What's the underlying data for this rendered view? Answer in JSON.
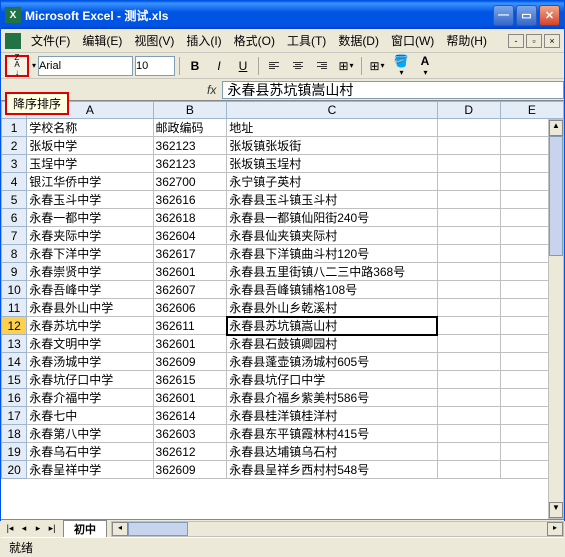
{
  "window": {
    "app": "Microsoft Excel",
    "file": "测试.xls",
    "title": "Microsoft Excel - 测试.xls"
  },
  "menu": {
    "file": "文件(F)",
    "edit": "编辑(E)",
    "view": "视图(V)",
    "insert": "插入(I)",
    "format": "格式(O)",
    "tools": "工具(T)",
    "data": "数据(D)",
    "window": "窗口(W)",
    "help": "帮助(H)"
  },
  "toolbar": {
    "sort_tooltip": "降序排序",
    "font_name": "Arial",
    "font_size": "10",
    "fill_color": "#ffff00",
    "font_color": "#ff0000"
  },
  "formula": {
    "fx": "fx",
    "value": "永春县苏坑镇嵩山村"
  },
  "columns": [
    "A",
    "B",
    "C",
    "D",
    "E"
  ],
  "selected_row": 12,
  "rows": [
    {
      "n": 1,
      "a": "学校名称",
      "b": "邮政编码",
      "c": "地址"
    },
    {
      "n": 2,
      "a": "张坂中学",
      "b": "362123",
      "c": "张坂镇张坂街"
    },
    {
      "n": 3,
      "a": "玉埕中学",
      "b": "362123",
      "c": "张坂镇玉埕村"
    },
    {
      "n": 4,
      "a": "银江华侨中学",
      "b": "362700",
      "c": "永宁镇子英村"
    },
    {
      "n": 5,
      "a": "永春玉斗中学",
      "b": "362616",
      "c": "永春县玉斗镇玉斗村"
    },
    {
      "n": 6,
      "a": "永春一都中学",
      "b": "362618",
      "c": "永春县一都镇仙阳街240号"
    },
    {
      "n": 7,
      "a": "永春夹际中学",
      "b": "362604",
      "c": "永春县仙夹镇夹际村"
    },
    {
      "n": 8,
      "a": "永春下洋中学",
      "b": "362617",
      "c": "永春县下洋镇曲斗村120号"
    },
    {
      "n": 9,
      "a": "永春崇贤中学",
      "b": "362601",
      "c": "永春县五里街镇八二三中路368号"
    },
    {
      "n": 10,
      "a": "永春吾峰中学",
      "b": "362607",
      "c": "永春县吾峰镇铺格108号"
    },
    {
      "n": 11,
      "a": "永春县外山中学",
      "b": "362606",
      "c": "永春县外山乡乾溪村"
    },
    {
      "n": 12,
      "a": "永春苏坑中学",
      "b": "362611",
      "c": "永春县苏坑镇嵩山村"
    },
    {
      "n": 13,
      "a": "永春文明中学",
      "b": "362601",
      "c": "永春县石鼓镇卿园村"
    },
    {
      "n": 14,
      "a": "永春汤城中学",
      "b": "362609",
      "c": "永春县蓬壶镇汤城村605号"
    },
    {
      "n": 15,
      "a": "永春坑仔口中学",
      "b": "362615",
      "c": "永春县坑仔口中学"
    },
    {
      "n": 16,
      "a": "永春介福中学",
      "b": "362601",
      "c": "永春县介福乡紫美村586号"
    },
    {
      "n": 17,
      "a": "永春七中",
      "b": "362614",
      "c": "永春县桂洋镇桂洋村"
    },
    {
      "n": 18,
      "a": "永春第八中学",
      "b": "362603",
      "c": "永春县东平镇霞林村415号"
    },
    {
      "n": 19,
      "a": "永春乌石中学",
      "b": "362612",
      "c": "永春县达埔镇乌石村"
    },
    {
      "n": 20,
      "a": "永春呈祥中学",
      "b": "362609",
      "c": "永春县呈祥乡西村村548号"
    }
  ],
  "sheet": {
    "active": "初中"
  },
  "status": {
    "ready": "就绪"
  }
}
